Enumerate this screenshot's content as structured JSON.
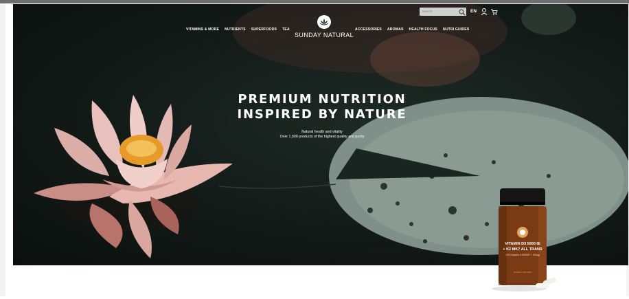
{
  "nav": {
    "left": [
      "VITAMINS & MORE",
      "NUTRIENTS",
      "SUPERFOODS",
      "TEA"
    ],
    "right": [
      "ACCESSORIES",
      "AROMAS",
      "HEALTH FOCUS",
      "NUTRI GUIDES"
    ]
  },
  "brand": {
    "name": "SUNDAY NATURAL",
    "logo_icon": "lotus-icon"
  },
  "header": {
    "search_placeholder": "Search...",
    "language": "EN",
    "icons": [
      "search-icon",
      "user-icon",
      "cart-icon"
    ]
  },
  "hero": {
    "headline_line1": "PREMIUM NUTRITION",
    "headline_line2": "INSPIRED BY NATURE",
    "sub_line1": "Natural health and vitality",
    "sub_line2": "Over 1,500 products of the highest quality and purity"
  },
  "product": {
    "label_line1": "VITAMIN D3 5000 IE",
    "label_line2": "+ K2 MK7 ALL TRANS",
    "label_line3": "120 Kapseln à 5000IE + 200µg",
    "brand_small": "SUNDAY NATURAL"
  },
  "colors": {
    "hero_dark": "#121a17",
    "lily_pad": "#8a9a92",
    "flower_pink": "#e9b9b4",
    "jar_amber": "#7a3a14"
  }
}
